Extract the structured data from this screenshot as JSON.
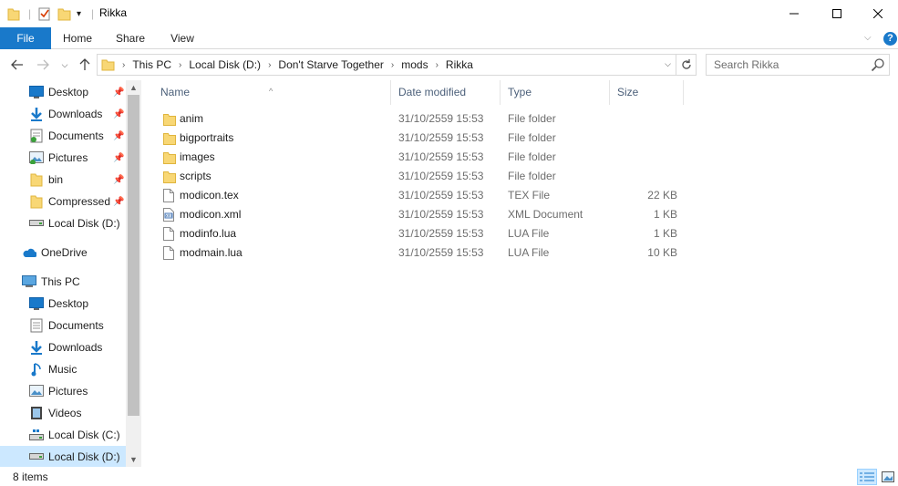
{
  "window": {
    "title": "Rikka"
  },
  "ribbon": {
    "tabs": [
      "File",
      "Home",
      "Share",
      "View"
    ]
  },
  "address": {
    "breadcrumbs": [
      "This PC",
      "Local Disk (D:)",
      "Don't Starve Together",
      "mods",
      "Rikka"
    ]
  },
  "search": {
    "placeholder": "Search Rikka"
  },
  "nav": {
    "quick_access": [
      {
        "label": "Desktop",
        "icon": "desktop-icon",
        "pinned": true
      },
      {
        "label": "Downloads",
        "icon": "downloads-icon",
        "pinned": true
      },
      {
        "label": "Documents",
        "icon": "documents-icon",
        "pinned": true
      },
      {
        "label": "Pictures",
        "icon": "pictures-icon",
        "pinned": true
      },
      {
        "label": "bin",
        "icon": "folder-icon",
        "pinned": true
      },
      {
        "label": "Compressed",
        "icon": "folder-icon",
        "pinned": true
      },
      {
        "label": "Local Disk (D:)",
        "icon": "drive-icon",
        "pinned": false
      }
    ],
    "onedrive": {
      "label": "OneDrive",
      "icon": "onedrive-icon"
    },
    "this_pc": {
      "label": "This PC",
      "icon": "computer-icon"
    },
    "this_pc_items": [
      {
        "label": "Desktop",
        "icon": "desktop-icon"
      },
      {
        "label": "Documents",
        "icon": "documents-icon"
      },
      {
        "label": "Downloads",
        "icon": "downloads-icon"
      },
      {
        "label": "Music",
        "icon": "music-icon"
      },
      {
        "label": "Pictures",
        "icon": "pictures-icon"
      },
      {
        "label": "Videos",
        "icon": "videos-icon"
      },
      {
        "label": "Local Disk (C:)",
        "icon": "windows-drive-icon"
      },
      {
        "label": "Local Disk (D:)",
        "icon": "drive-icon"
      }
    ]
  },
  "list": {
    "columns": [
      "Name",
      "Date modified",
      "Type",
      "Size"
    ],
    "files": [
      {
        "name": "anim",
        "date": "31/10/2559 15:53",
        "type": "File folder",
        "size": "",
        "icon": "folder-icon"
      },
      {
        "name": "bigportraits",
        "date": "31/10/2559 15:53",
        "type": "File folder",
        "size": "",
        "icon": "folder-icon"
      },
      {
        "name": "images",
        "date": "31/10/2559 15:53",
        "type": "File folder",
        "size": "",
        "icon": "folder-icon"
      },
      {
        "name": "scripts",
        "date": "31/10/2559 15:53",
        "type": "File folder",
        "size": "",
        "icon": "folder-icon"
      },
      {
        "name": "modicon.tex",
        "date": "31/10/2559 15:53",
        "type": "TEX File",
        "size": "22 KB",
        "icon": "file-icon"
      },
      {
        "name": "modicon.xml",
        "date": "31/10/2559 15:53",
        "type": "XML Document",
        "size": "1 KB",
        "icon": "xml-file-icon"
      },
      {
        "name": "modinfo.lua",
        "date": "31/10/2559 15:53",
        "type": "LUA File",
        "size": "1 KB",
        "icon": "file-icon"
      },
      {
        "name": "modmain.lua",
        "date": "31/10/2559 15:53",
        "type": "LUA File",
        "size": "10 KB",
        "icon": "file-icon"
      }
    ]
  },
  "status": {
    "count": "8 items"
  },
  "colors": {
    "accent": "#1979ca",
    "folder": "#f8d775",
    "selection": "#cce8ff"
  }
}
